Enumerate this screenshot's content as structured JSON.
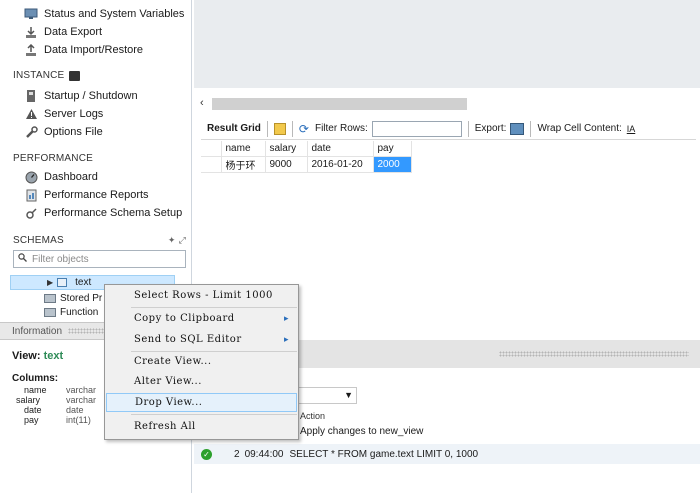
{
  "navigator": {
    "management_items": [
      {
        "label": "Status and System Variables",
        "icon": "monitor-icon"
      },
      {
        "label": "Data Export",
        "icon": "export-icon"
      },
      {
        "label": "Data Import/Restore",
        "icon": "import-icon"
      }
    ],
    "instance_title": "INSTANCE",
    "instance_items": [
      {
        "label": "Startup / Shutdown",
        "icon": "power-icon"
      },
      {
        "label": "Server Logs",
        "icon": "warning-icon"
      },
      {
        "label": "Options File",
        "icon": "wrench-icon"
      }
    ],
    "performance_title": "PERFORMANCE",
    "performance_items": [
      {
        "label": "Dashboard",
        "icon": "gauge-icon"
      },
      {
        "label": "Performance Reports",
        "icon": "report-icon"
      },
      {
        "label": "Performance Schema Setup",
        "icon": "setup-icon"
      }
    ],
    "schemas_title": "SCHEMAS",
    "filter_placeholder": "Filter objects",
    "tree": {
      "selected": "text",
      "stored_procedures": "Stored Pr",
      "functions": "Function"
    }
  },
  "info_panel": {
    "tab": "Information",
    "view_label": "View:",
    "view_name": "text",
    "columns_label": "Columns:",
    "columns": [
      {
        "name": "name",
        "type": "varchar"
      },
      {
        "name": "salary",
        "type": "varchar"
      },
      {
        "name": "date",
        "type": "date"
      },
      {
        "name": "pay",
        "type": "int(11)"
      }
    ]
  },
  "result_toolbar": {
    "result_grid_label": "Result Grid",
    "filter_rows_label": "Filter Rows:",
    "export_label": "Export:",
    "wrap_label": "Wrap Cell Content:"
  },
  "result_grid": {
    "columns": [
      "name",
      "salary",
      "date",
      "pay"
    ],
    "rows": [
      [
        "杨于环",
        "9000",
        "2016-01-20",
        "2000"
      ]
    ]
  },
  "output": {
    "action_header": "Action",
    "action_row1": "Apply changes to new_view",
    "row2_num": "2",
    "row2_time": "09:44:00",
    "row2_action": "SELECT * FROM game.text LIMIT 0, 1000"
  },
  "context_menu": {
    "items": [
      {
        "label": "Select Rows - Limit 1000",
        "submenu": false
      },
      {
        "label": "Copy to Clipboard",
        "submenu": true
      },
      {
        "label": "Send to SQL Editor",
        "submenu": true
      },
      {
        "label": "Create View...",
        "submenu": false
      },
      {
        "label": "Alter View...",
        "submenu": false
      },
      {
        "label": "Drop View...",
        "submenu": false,
        "highlighted": true
      },
      {
        "label": "Refresh All",
        "submenu": false
      }
    ],
    "submenu_arrow": "▸"
  },
  "colors": {
    "selection": "#3399ff",
    "tree_highlight": "#cde8ff",
    "menu_highlight": "#e5f1fb",
    "success": "#2ca02c",
    "view_name": "#2e8b57"
  }
}
